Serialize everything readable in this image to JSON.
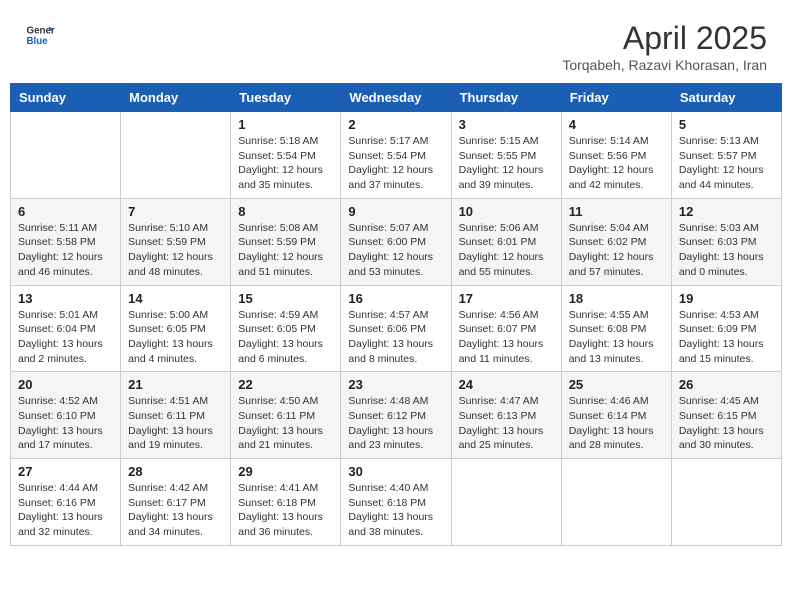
{
  "header": {
    "logo_general": "General",
    "logo_blue": "Blue",
    "month_year": "April 2025",
    "location": "Torqabeh, Razavi Khorasan, Iran"
  },
  "weekdays": [
    "Sunday",
    "Monday",
    "Tuesday",
    "Wednesday",
    "Thursday",
    "Friday",
    "Saturday"
  ],
  "weeks": [
    [
      null,
      null,
      {
        "day": 1,
        "sunrise": "5:18 AM",
        "sunset": "5:54 PM",
        "daylight": "12 hours and 35 minutes."
      },
      {
        "day": 2,
        "sunrise": "5:17 AM",
        "sunset": "5:54 PM",
        "daylight": "12 hours and 37 minutes."
      },
      {
        "day": 3,
        "sunrise": "5:15 AM",
        "sunset": "5:55 PM",
        "daylight": "12 hours and 39 minutes."
      },
      {
        "day": 4,
        "sunrise": "5:14 AM",
        "sunset": "5:56 PM",
        "daylight": "12 hours and 42 minutes."
      },
      {
        "day": 5,
        "sunrise": "5:13 AM",
        "sunset": "5:57 PM",
        "daylight": "12 hours and 44 minutes."
      }
    ],
    [
      {
        "day": 6,
        "sunrise": "5:11 AM",
        "sunset": "5:58 PM",
        "daylight": "12 hours and 46 minutes."
      },
      {
        "day": 7,
        "sunrise": "5:10 AM",
        "sunset": "5:59 PM",
        "daylight": "12 hours and 48 minutes."
      },
      {
        "day": 8,
        "sunrise": "5:08 AM",
        "sunset": "5:59 PM",
        "daylight": "12 hours and 51 minutes."
      },
      {
        "day": 9,
        "sunrise": "5:07 AM",
        "sunset": "6:00 PM",
        "daylight": "12 hours and 53 minutes."
      },
      {
        "day": 10,
        "sunrise": "5:06 AM",
        "sunset": "6:01 PM",
        "daylight": "12 hours and 55 minutes."
      },
      {
        "day": 11,
        "sunrise": "5:04 AM",
        "sunset": "6:02 PM",
        "daylight": "12 hours and 57 minutes."
      },
      {
        "day": 12,
        "sunrise": "5:03 AM",
        "sunset": "6:03 PM",
        "daylight": "13 hours and 0 minutes."
      }
    ],
    [
      {
        "day": 13,
        "sunrise": "5:01 AM",
        "sunset": "6:04 PM",
        "daylight": "13 hours and 2 minutes."
      },
      {
        "day": 14,
        "sunrise": "5:00 AM",
        "sunset": "6:05 PM",
        "daylight": "13 hours and 4 minutes."
      },
      {
        "day": 15,
        "sunrise": "4:59 AM",
        "sunset": "6:05 PM",
        "daylight": "13 hours and 6 minutes."
      },
      {
        "day": 16,
        "sunrise": "4:57 AM",
        "sunset": "6:06 PM",
        "daylight": "13 hours and 8 minutes."
      },
      {
        "day": 17,
        "sunrise": "4:56 AM",
        "sunset": "6:07 PM",
        "daylight": "13 hours and 11 minutes."
      },
      {
        "day": 18,
        "sunrise": "4:55 AM",
        "sunset": "6:08 PM",
        "daylight": "13 hours and 13 minutes."
      },
      {
        "day": 19,
        "sunrise": "4:53 AM",
        "sunset": "6:09 PM",
        "daylight": "13 hours and 15 minutes."
      }
    ],
    [
      {
        "day": 20,
        "sunrise": "4:52 AM",
        "sunset": "6:10 PM",
        "daylight": "13 hours and 17 minutes."
      },
      {
        "day": 21,
        "sunrise": "4:51 AM",
        "sunset": "6:11 PM",
        "daylight": "13 hours and 19 minutes."
      },
      {
        "day": 22,
        "sunrise": "4:50 AM",
        "sunset": "6:11 PM",
        "daylight": "13 hours and 21 minutes."
      },
      {
        "day": 23,
        "sunrise": "4:48 AM",
        "sunset": "6:12 PM",
        "daylight": "13 hours and 23 minutes."
      },
      {
        "day": 24,
        "sunrise": "4:47 AM",
        "sunset": "6:13 PM",
        "daylight": "13 hours and 25 minutes."
      },
      {
        "day": 25,
        "sunrise": "4:46 AM",
        "sunset": "6:14 PM",
        "daylight": "13 hours and 28 minutes."
      },
      {
        "day": 26,
        "sunrise": "4:45 AM",
        "sunset": "6:15 PM",
        "daylight": "13 hours and 30 minutes."
      }
    ],
    [
      {
        "day": 27,
        "sunrise": "4:44 AM",
        "sunset": "6:16 PM",
        "daylight": "13 hours and 32 minutes."
      },
      {
        "day": 28,
        "sunrise": "4:42 AM",
        "sunset": "6:17 PM",
        "daylight": "13 hours and 34 minutes."
      },
      {
        "day": 29,
        "sunrise": "4:41 AM",
        "sunset": "6:18 PM",
        "daylight": "13 hours and 36 minutes."
      },
      {
        "day": 30,
        "sunrise": "4:40 AM",
        "sunset": "6:18 PM",
        "daylight": "13 hours and 38 minutes."
      },
      null,
      null,
      null
    ]
  ]
}
